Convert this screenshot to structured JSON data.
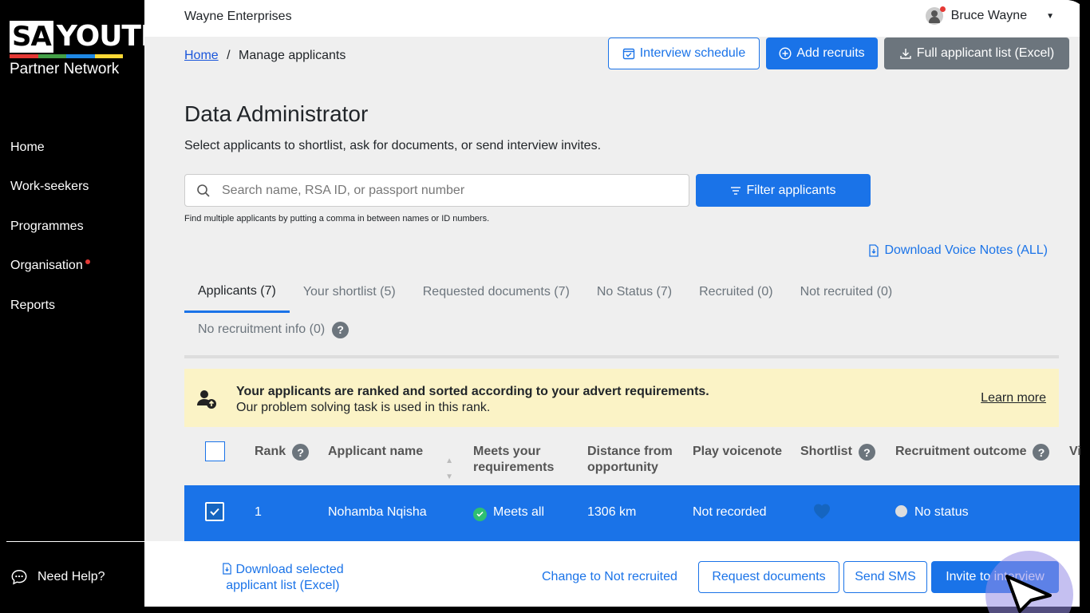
{
  "brand": {
    "logo_left": "SA",
    "logo_right": "YOUTH",
    "tagline": "Partner Network",
    "stripe_colors": [
      "#e53935",
      "#43a047",
      "#1e88e5",
      "#fdd835"
    ]
  },
  "sidebar": {
    "items": [
      {
        "label": "Home"
      },
      {
        "label": "Work-seekers"
      },
      {
        "label": "Programmes"
      },
      {
        "label": "Organisation",
        "notify": true
      },
      {
        "label": "Reports"
      }
    ],
    "help_label": "Need Help?"
  },
  "topbar": {
    "org_name": "Wayne Enterprises",
    "user_name": "Bruce Wayne"
  },
  "breadcrumb": {
    "home": "Home",
    "separator": "/",
    "current": "Manage applicants"
  },
  "actions": {
    "interview_schedule": "Interview schedule",
    "add_recruits": "Add recruits",
    "full_list": "Full applicant list (Excel)"
  },
  "page": {
    "title": "Data Administrator",
    "subtitle": "Select applicants to shortlist, ask for documents, or send interview invites."
  },
  "search": {
    "placeholder": "Search name, RSA ID, or passport number",
    "hint": "Find multiple applicants by putting a comma in between names or ID numbers.",
    "filter_label": "Filter applicants"
  },
  "voice_notes_link": "Download Voice Notes (ALL)",
  "tabs": [
    {
      "label": "Applicants (7)",
      "active": true
    },
    {
      "label": "Your shortlist (5)"
    },
    {
      "label": "Requested documents (7)"
    },
    {
      "label": "No Status (7)"
    },
    {
      "label": "Recruited (0)"
    },
    {
      "label": "Not recruited (0)"
    }
  ],
  "tab_second_row": {
    "label": "No recruitment info (0)"
  },
  "banner": {
    "line1": "Your applicants are ranked and sorted according to your advert requirements.",
    "line2": "Our problem solving task is used in this rank.",
    "learn_more": "Learn more"
  },
  "table": {
    "headers": {
      "rank": "Rank",
      "name": "Applicant name",
      "meets_1": "Meets your",
      "meets_2": "requirements",
      "distance_1": "Distance from",
      "distance_2": "opportunity",
      "voicenote": "Play voicenote",
      "shortlist": "Shortlist",
      "outcome": "Recruitment outcome",
      "overflow": "Vi"
    },
    "rows": [
      {
        "selected": true,
        "rank": "1",
        "name": "Nohamba Nqisha",
        "meets": "Meets all",
        "distance": "1306 km",
        "voicenote": "Not recorded",
        "shortlisted": true,
        "outcome": "No status"
      }
    ]
  },
  "bottombar": {
    "download_line1": "Download selected",
    "download_line2": "applicant list (Excel)",
    "change_not_recruited": "Change to Not recruited",
    "request_documents": "Request documents",
    "send_sms": "Send SMS",
    "invite": "Invite to interview"
  },
  "colors": {
    "primary": "#1a73e8",
    "gray_button": "#6c757d",
    "banner_bg": "#fbf3c6",
    "success": "#2fbf71",
    "notify": "#e53935"
  }
}
